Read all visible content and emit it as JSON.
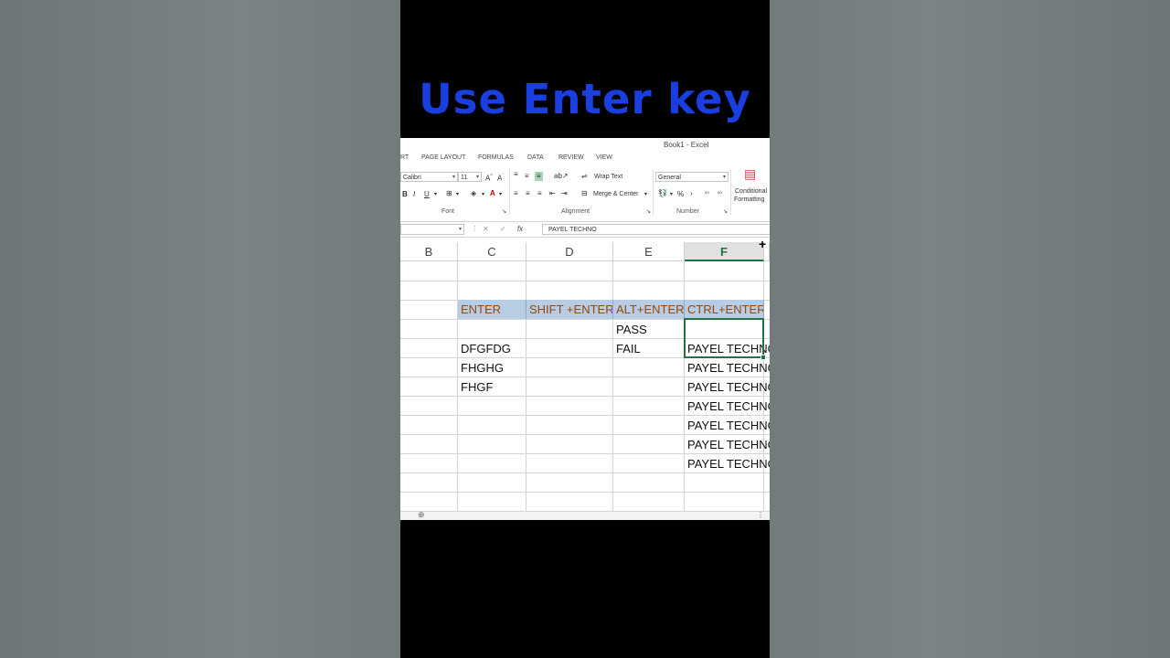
{
  "headline": "Use Enter key",
  "window_title": "Book1 - Excel",
  "tabs": [
    "RT",
    "PAGE LAYOUT",
    "FORMULAS",
    "DATA",
    "REVIEW",
    "VIEW"
  ],
  "ribbon": {
    "font_name": "Calibri",
    "font_size": "11",
    "bold": "B",
    "italic": "I",
    "underline": "U",
    "wrap_text": "Wrap Text",
    "merge_center": "Merge & Center",
    "number_format": "General",
    "percent": "%",
    "comma": "›",
    "conditional_formatting_1": "Conditional",
    "conditional_formatting_2": "Formatting",
    "group_font": "Font",
    "group_alignment": "Alignment",
    "group_number": "Number"
  },
  "formula_bar": {
    "cancel_glyph": "✕",
    "enter_glyph": "✓",
    "fx_glyph": "fx",
    "value": "PAYEL TECHNO"
  },
  "columns": [
    "B",
    "C",
    "D",
    "E",
    "F"
  ],
  "selected_column": "F",
  "header_row": [
    "ENTER",
    "SHIFT +ENTER",
    "ALT+ENTER",
    "CTRL+ENTER"
  ],
  "cells": {
    "e_row1": "PASS",
    "c_row2": "DFGFDG",
    "e_row2": "FAIL",
    "f_row2": "PAYEL TECHNO",
    "c_row3": "FHGHG",
    "f_row3": "PAYEL TECHNO",
    "c_row4": "FHGF",
    "f_row4": "PAYEL TECHNO",
    "f_row5": "PAYEL TECHNO",
    "f_row6": "PAYEL TECHNO",
    "f_row7": "PAYEL TECHNO",
    "f_row8": "PAYEL TECHNO"
  },
  "colors": {
    "headline": "#1a3fe0",
    "header_fill": "#b8cce4",
    "header_text": "#974706",
    "excel_green": "#217346"
  }
}
